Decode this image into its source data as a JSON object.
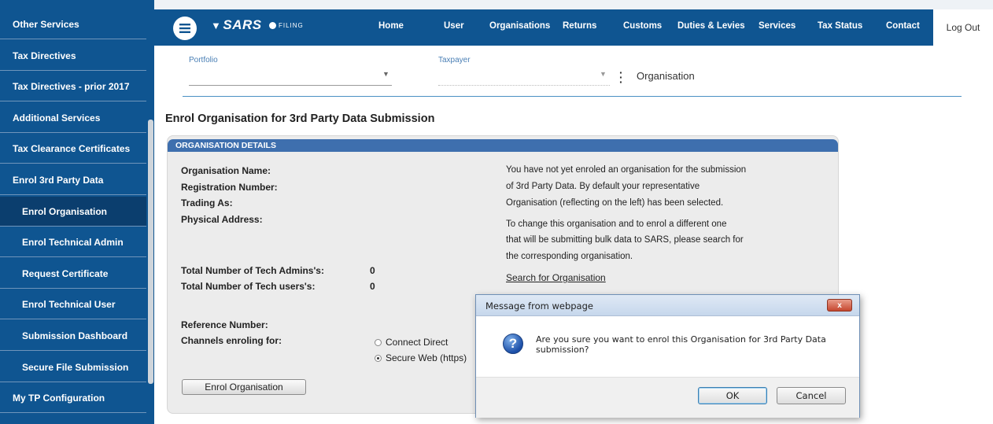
{
  "sidebar": {
    "items": [
      {
        "label": "Other Services"
      },
      {
        "label": "Tax Directives"
      },
      {
        "label": "Tax Directives - prior 2017"
      },
      {
        "label": "Additional Services"
      },
      {
        "label": "Tax Clearance Certificates"
      },
      {
        "label": "Enrol 3rd Party Data"
      },
      {
        "label": "Enrol Organisation"
      },
      {
        "label": "Enrol Technical Admin"
      },
      {
        "label": "Request Certificate"
      },
      {
        "label": "Enrol Technical User"
      },
      {
        "label": "Submission Dashboard"
      },
      {
        "label": "Secure File Submission"
      },
      {
        "label": "My TP Configuration"
      }
    ]
  },
  "topnav": {
    "logo": "SARS",
    "logo_sub": "FILING",
    "links": [
      "Home",
      "User",
      "Organisations",
      "Returns",
      "Customs",
      "Duties & Levies",
      "Services",
      "Tax Status",
      "Contact"
    ],
    "logout": "Log Out"
  },
  "selectors": {
    "portfolio_label": "Portfolio",
    "taxpayer_label": "Taxpayer",
    "context": "Organisation"
  },
  "page": {
    "title": "Enrol Organisation for 3rd Party Data Submission"
  },
  "panel": {
    "header": "ORGANISATION DETAILS",
    "labels": {
      "org_name": "Organisation Name:",
      "reg_number": "Registration Number:",
      "trading_as": "Trading As:",
      "address": "Physical Address:",
      "tech_admins": "Total Number of Tech Admins's:",
      "tech_users": "Total Number of Tech users's:",
      "reference": "Reference Number:",
      "channels": "Channels enroling for:"
    },
    "values": {
      "tech_admins": "0",
      "tech_users": "0"
    },
    "info_lines_1": [
      "You have not yet enroled an organisation for the submission",
      "of 3rd Party Data. By default your representative",
      "Organisation (reflecting on the left) has been selected."
    ],
    "info_lines_2": [
      "To change this organisation and to enrol a different one",
      "that will be submitting bulk data to SARS, please search for",
      "the corresponding organisation."
    ],
    "search_link": "Search for Organisation",
    "radio_options": [
      {
        "label": "Connect Direct",
        "selected": false
      },
      {
        "label": "Secure Web (https)",
        "selected": true
      }
    ],
    "enrol_button": "Enrol Organisation"
  },
  "dialog": {
    "title": "Message from webpage",
    "close": "x",
    "icon": "question-icon",
    "message": "Are you sure you want to enrol this Organisation for 3rd Party Data submission?",
    "ok": "OK",
    "cancel": "Cancel"
  },
  "colors": {
    "brand_blue": "#0f5591",
    "active_item": "#0b3e6e",
    "panel_header": "#3e6fae"
  }
}
